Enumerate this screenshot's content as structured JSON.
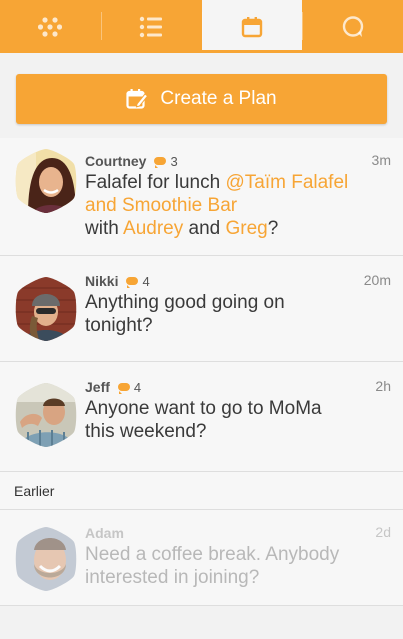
{
  "tabs": [
    {
      "icon": "dots-icon",
      "active": false
    },
    {
      "icon": "list-icon",
      "active": false
    },
    {
      "icon": "calendar-icon",
      "active": true
    },
    {
      "icon": "chat-icon",
      "active": false
    }
  ],
  "create_plan": {
    "label": "Create a Plan",
    "icon": "calendar-edit-icon"
  },
  "colors": {
    "accent": "#f7a535",
    "background": "#f2f2f2",
    "text": "#3a3a3a"
  },
  "feed": [
    {
      "name": "Courtney",
      "comments": "3",
      "time": "3m",
      "message": {
        "part1": "Falafel for lunch ",
        "mention": "@Taïm Falafel and Smoothie Bar",
        "part2": "with ",
        "person1": "Audrey",
        "and": " and ",
        "person2": "Greg",
        "end": "?"
      }
    },
    {
      "name": "Nikki",
      "comments": "4",
      "time": "20m",
      "message": "Anything good going on tonight?"
    },
    {
      "name": "Jeff",
      "comments": "4",
      "time": "2h",
      "message": "Anyone want to go to MoMa this weekend?"
    }
  ],
  "earlier": {
    "header": "Earlier",
    "items": [
      {
        "name": "Adam",
        "time": "2d",
        "message": "Need a coffee break. Anybody interested in joining?"
      }
    ]
  }
}
